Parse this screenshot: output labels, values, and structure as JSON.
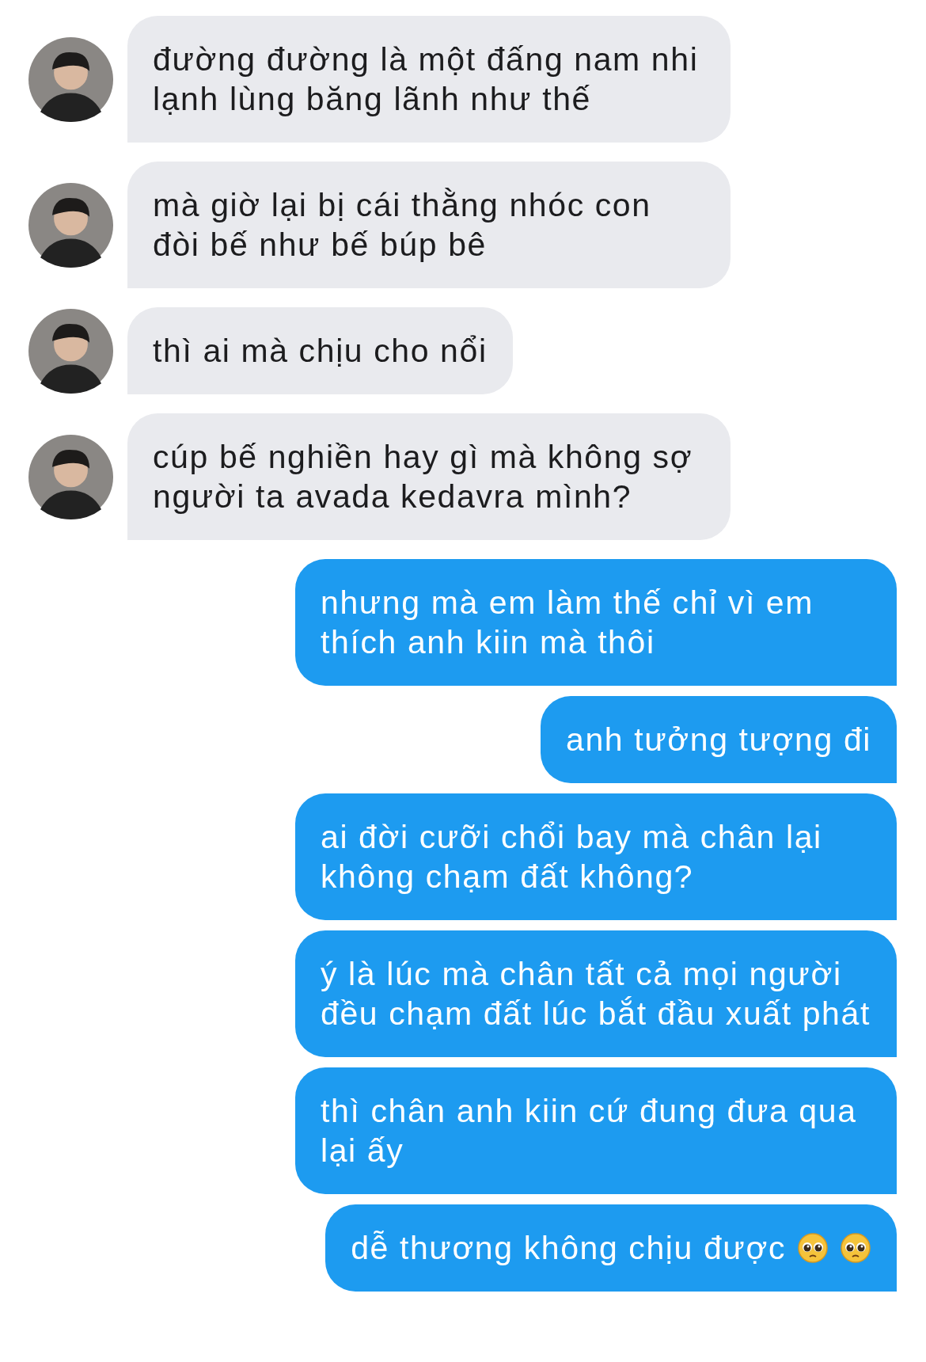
{
  "messages": [
    {
      "kind": "received",
      "text": "đường đường là một đấng nam nhi lạnh lùng băng lãnh như thế"
    },
    {
      "kind": "received",
      "text": "mà giờ lại bị cái thằng nhóc con đòi bế như bế búp bê"
    },
    {
      "kind": "received",
      "text": "thì ai mà chịu cho nổi"
    },
    {
      "kind": "received",
      "text": "cúp bế nghiền hay gì mà không sợ người ta avada kedavra mình?"
    },
    {
      "kind": "sent",
      "text": "nhưng mà em làm thế chỉ vì em thích anh kiin mà thôi"
    },
    {
      "kind": "sent",
      "text": "anh tưởng tượng đi"
    },
    {
      "kind": "sent",
      "text": "ai đời cưỡi chổi bay mà chân lại không chạm đất không?"
    },
    {
      "kind": "sent",
      "text": "ý là lúc mà chân tất cả mọi người đều chạm đất lúc bắt đầu xuất phát"
    },
    {
      "kind": "sent",
      "text": "thì chân anh kiin cứ đung đưa qua lại ấy"
    },
    {
      "kind": "sent",
      "text": "dễ thương không chịu được",
      "emojis": [
        {
          "kind": "pleading"
        },
        {
          "kind": "pleading"
        }
      ]
    }
  ]
}
